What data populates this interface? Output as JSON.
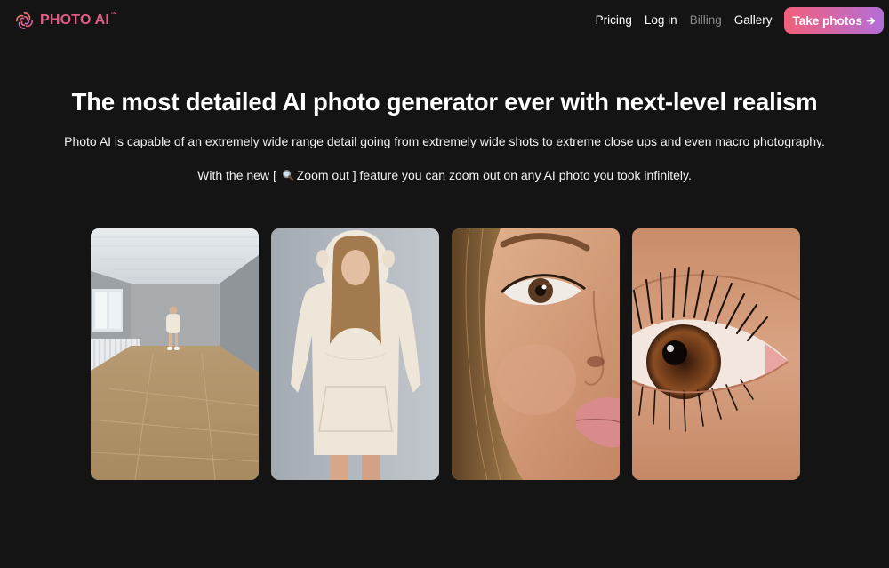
{
  "header": {
    "logo_text": "PHOTO AI",
    "logo_tm": "™",
    "logo_icon": "swirl-logo-icon",
    "nav": [
      {
        "label": "Pricing",
        "state": "default"
      },
      {
        "label": "Log in",
        "state": "default"
      },
      {
        "label": "Billing",
        "state": "muted"
      },
      {
        "label": "Gallery",
        "state": "default"
      }
    ],
    "cta_label": "Take photos",
    "cta_icon": "arrow-right-icon",
    "colors": {
      "background": "#151414",
      "brand": "#e35d86",
      "cta_gradient_start": "#f25f79",
      "cta_gradient_end": "#b36ed8",
      "muted_link": "#8d8d8d"
    }
  },
  "hero": {
    "headline": "The most detailed AI photo generator ever with next-level realism",
    "subline": "Photo AI is capable of an extremely wide range detail going from extremely wide shots to extreme close ups and even macro photography.",
    "feature_prefix": "With the new [",
    "feature_icon": "magnifying-glass-icon",
    "feature_name": "Zoom out ]",
    "feature_suffix": "feature you can zoom out on any AI photo you took infinitely."
  },
  "gallery": {
    "images": [
      {
        "subject": "wide-shot-room"
      },
      {
        "subject": "full-body-hoodie"
      },
      {
        "subject": "face-close-up"
      },
      {
        "subject": "eye-macro"
      }
    ]
  }
}
